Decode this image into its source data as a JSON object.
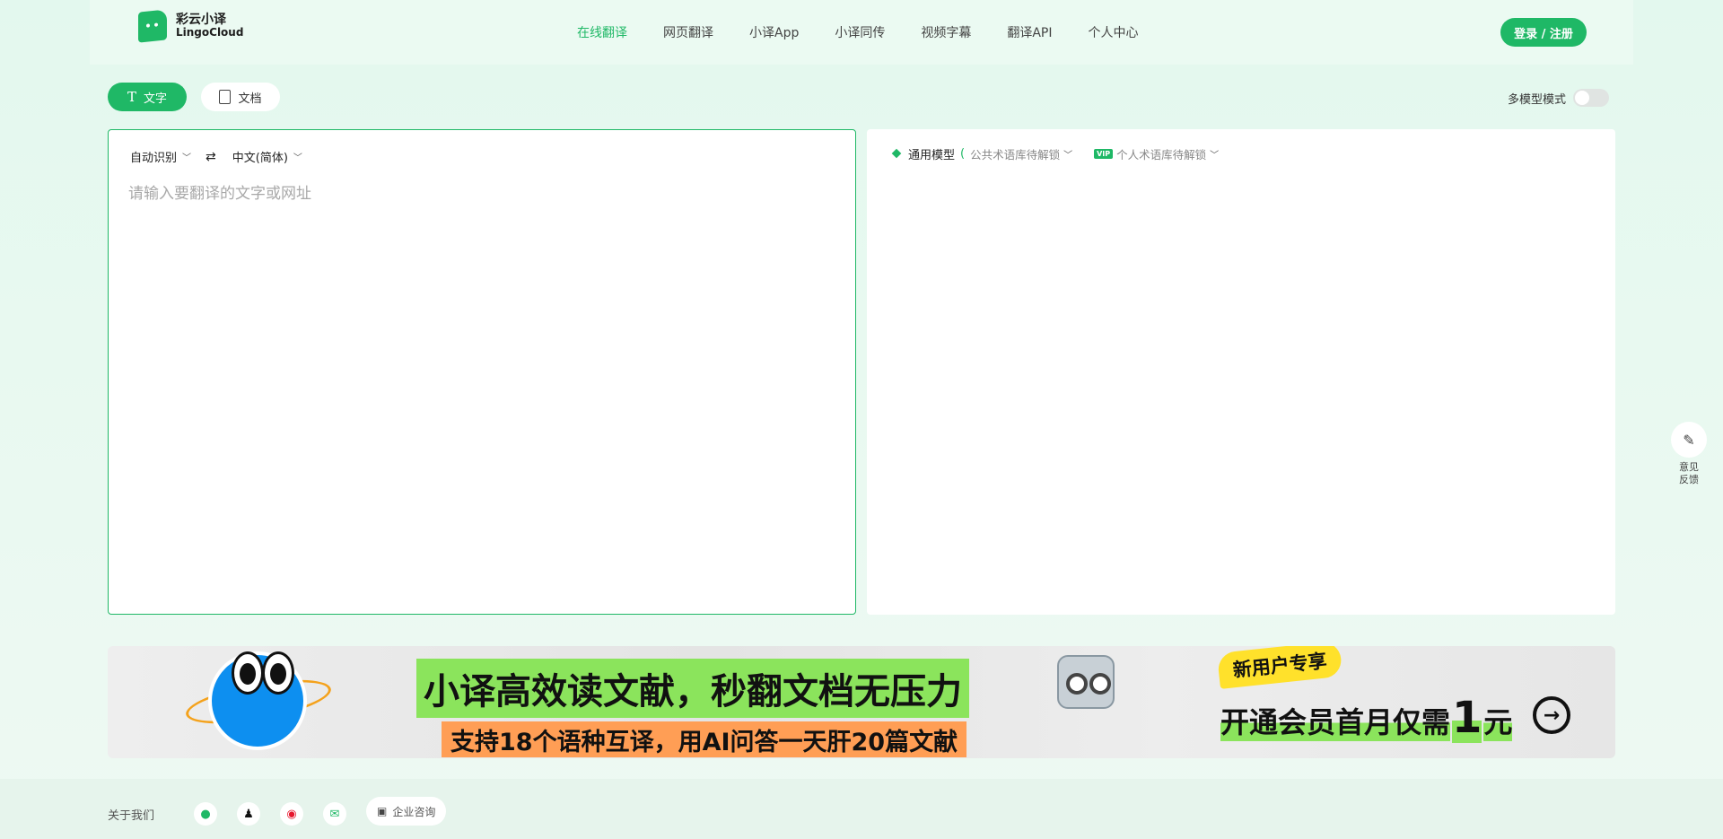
{
  "header": {
    "logo_cn": "彩云小译",
    "logo_en": "LingoCloud",
    "nav": [
      {
        "label": "在线翻译",
        "active": true
      },
      {
        "label": "网页翻译"
      },
      {
        "label": "小译App"
      },
      {
        "label": "小译同传"
      },
      {
        "label": "视频字幕"
      },
      {
        "label": "翻译API"
      },
      {
        "label": "个人中心"
      }
    ],
    "login_label": "登录 / 注册"
  },
  "mode": {
    "text_tab": "文字",
    "doc_tab": "文档",
    "multi_model_label": "多模型模式",
    "multi_model_on": false
  },
  "source": {
    "source_lang": "自动识别",
    "target_lang": "中文(简体)",
    "placeholder": "请输入要翻译的文字或网址"
  },
  "target": {
    "model_name": "通用模型",
    "public_term": "公共术语库待解锁",
    "vip_badge": "VIP",
    "personal_term": "个人术语库待解锁"
  },
  "feedback": {
    "label_1": "意见",
    "label_2": "反馈"
  },
  "banner": {
    "headline": "小译高效读文献，秒翻文档无压力",
    "subline": "支持18个语种互译，用AI问答一天肝20篇文献",
    "new_user": "新用户专享",
    "promo_pre": "开通会员首月仅需",
    "promo_num": "1",
    "promo_unit": "元"
  },
  "footer": {
    "about": "关于我们",
    "enterprise": "企业咨询"
  },
  "colors": {
    "brand": "#1fb866",
    "banner_green": "#8be45c",
    "banner_orange": "#ff9e55",
    "banner_yellow": "#ffe12b"
  }
}
